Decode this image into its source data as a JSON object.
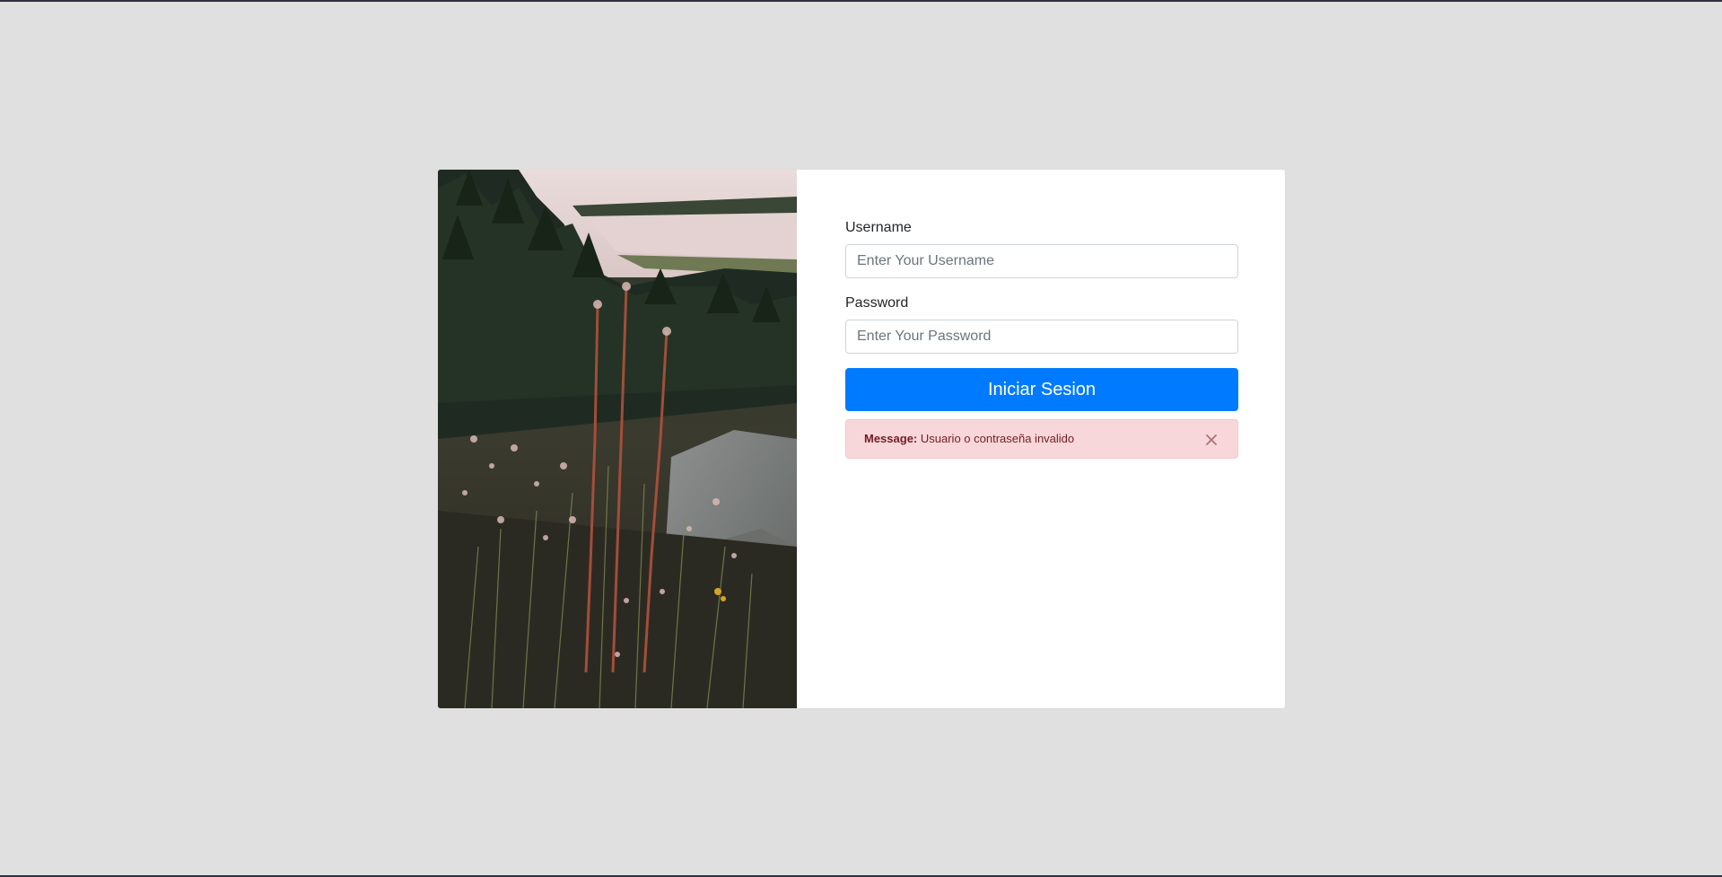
{
  "form": {
    "username_label": "Username",
    "username_placeholder": "Enter Your Username",
    "password_label": "Password",
    "password_placeholder": "Enter Your Password",
    "submit_label": "Iniciar Sesion"
  },
  "alert": {
    "title": "Message:",
    "text": "Usuario o contraseña invalido",
    "close_icon": "close-icon"
  },
  "photo": {
    "icon": "nature-photo"
  },
  "colors": {
    "background": "#e0e0e0",
    "primary": "#007bff",
    "alert_background": "#f8d7da",
    "alert_text": "#721c24"
  }
}
